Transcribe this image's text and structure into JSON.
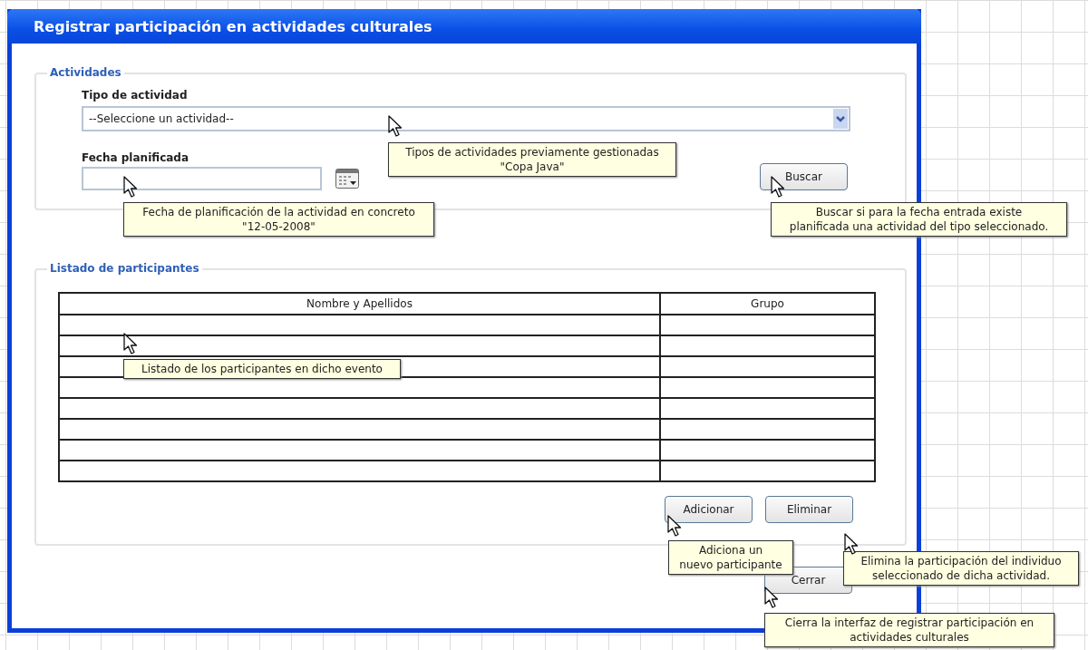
{
  "window": {
    "title": "Registrar participación en actividades culturales"
  },
  "activities": {
    "legend": "Actividades",
    "type_label": "Tipo de actividad",
    "type_select": {
      "value": "--Seleccione un actividad--"
    },
    "date_label": "Fecha planificada",
    "search_button": "Buscar"
  },
  "participants": {
    "legend": "Listado de participantes",
    "columns": [
      "Nombre y Apellidos",
      "Grupo"
    ],
    "add_button": "Adicionar",
    "remove_button": "Eliminar"
  },
  "close_button": "Cerrar",
  "notes": [
    {
      "lines": [
        "Tipos de actividades previamente gestionadas",
        "\"Copa Java\""
      ]
    },
    {
      "lines": [
        "Fecha de planificación de la actividad en concreto",
        "\"12-05-2008\""
      ]
    },
    {
      "lines": [
        "Buscar si para la fecha entrada existe",
        "planificada una actividad del tipo seleccionado."
      ]
    },
    {
      "lines": [
        "Listado de los participantes en dicho evento"
      ]
    },
    {
      "lines": [
        "Adiciona un",
        "nuevo participante"
      ]
    },
    {
      "lines": [
        "Elimina la participación del individuo",
        "seleccionado de dicha actividad."
      ]
    },
    {
      "lines": [
        "Cierra la interfaz de registrar participación en",
        "actividades culturales"
      ]
    }
  ]
}
